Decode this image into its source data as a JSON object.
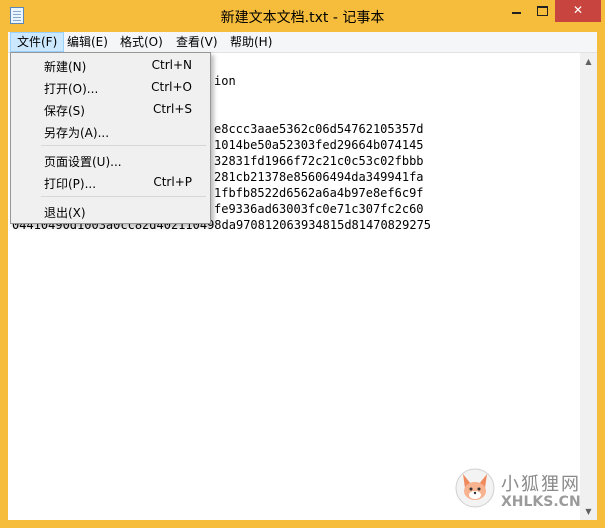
{
  "window": {
    "title": "新建文本文档.txt - 记事本",
    "controls": {
      "minimize": "",
      "maximize": "",
      "close": "✕"
    }
  },
  "menubar": {
    "items": [
      {
        "label": "文件(F)",
        "active": true
      },
      {
        "label": "编辑(E)"
      },
      {
        "label": "格式(O)"
      },
      {
        "label": "查看(V)"
      },
      {
        "label": "帮助(H)"
      }
    ]
  },
  "file_menu": {
    "items": [
      {
        "label": "新建(N)",
        "shortcut": "Ctrl+N"
      },
      {
        "label": "打开(O)...",
        "shortcut": "Ctrl+O"
      },
      {
        "label": "保存(S)",
        "shortcut": "Ctrl+S"
      },
      {
        "label": "另存为(A)...",
        "shortcut": ""
      },
      {
        "label": "页面设置(U)...",
        "shortcut": ""
      },
      {
        "label": "打印(P)...",
        "shortcut": "Ctrl+P"
      },
      {
        "label": "退出(X)",
        "shortcut": ""
      }
    ]
  },
  "editor": {
    "lines": [
      {
        "text": "ion"
      },
      {
        "text": "e8ccc3aae5362c06d54762105357d"
      },
      {
        "text": "1014be50a52303fed29664b074145"
      },
      {
        "text": "32831fd1966f72c21c0c53c02fbbb"
      },
      {
        "text": "281cb21378e85606494da349941fa"
      },
      {
        "text": "1fbfb8522d6562a6a4b97e8ef6c9f"
      },
      {
        "text": "fe9336ad63003fc0e71c307fc2c60"
      },
      {
        "text": "04410490d1003a0cc82d402110498da970812063934815d81470829275"
      }
    ]
  },
  "watermark": {
    "cn": "小狐狸网",
    "en": "XHLKS.CN"
  },
  "colors": {
    "frame": "#f6bd3d",
    "close_button": "#c7453e",
    "menu_highlight": "#cce8ff"
  }
}
